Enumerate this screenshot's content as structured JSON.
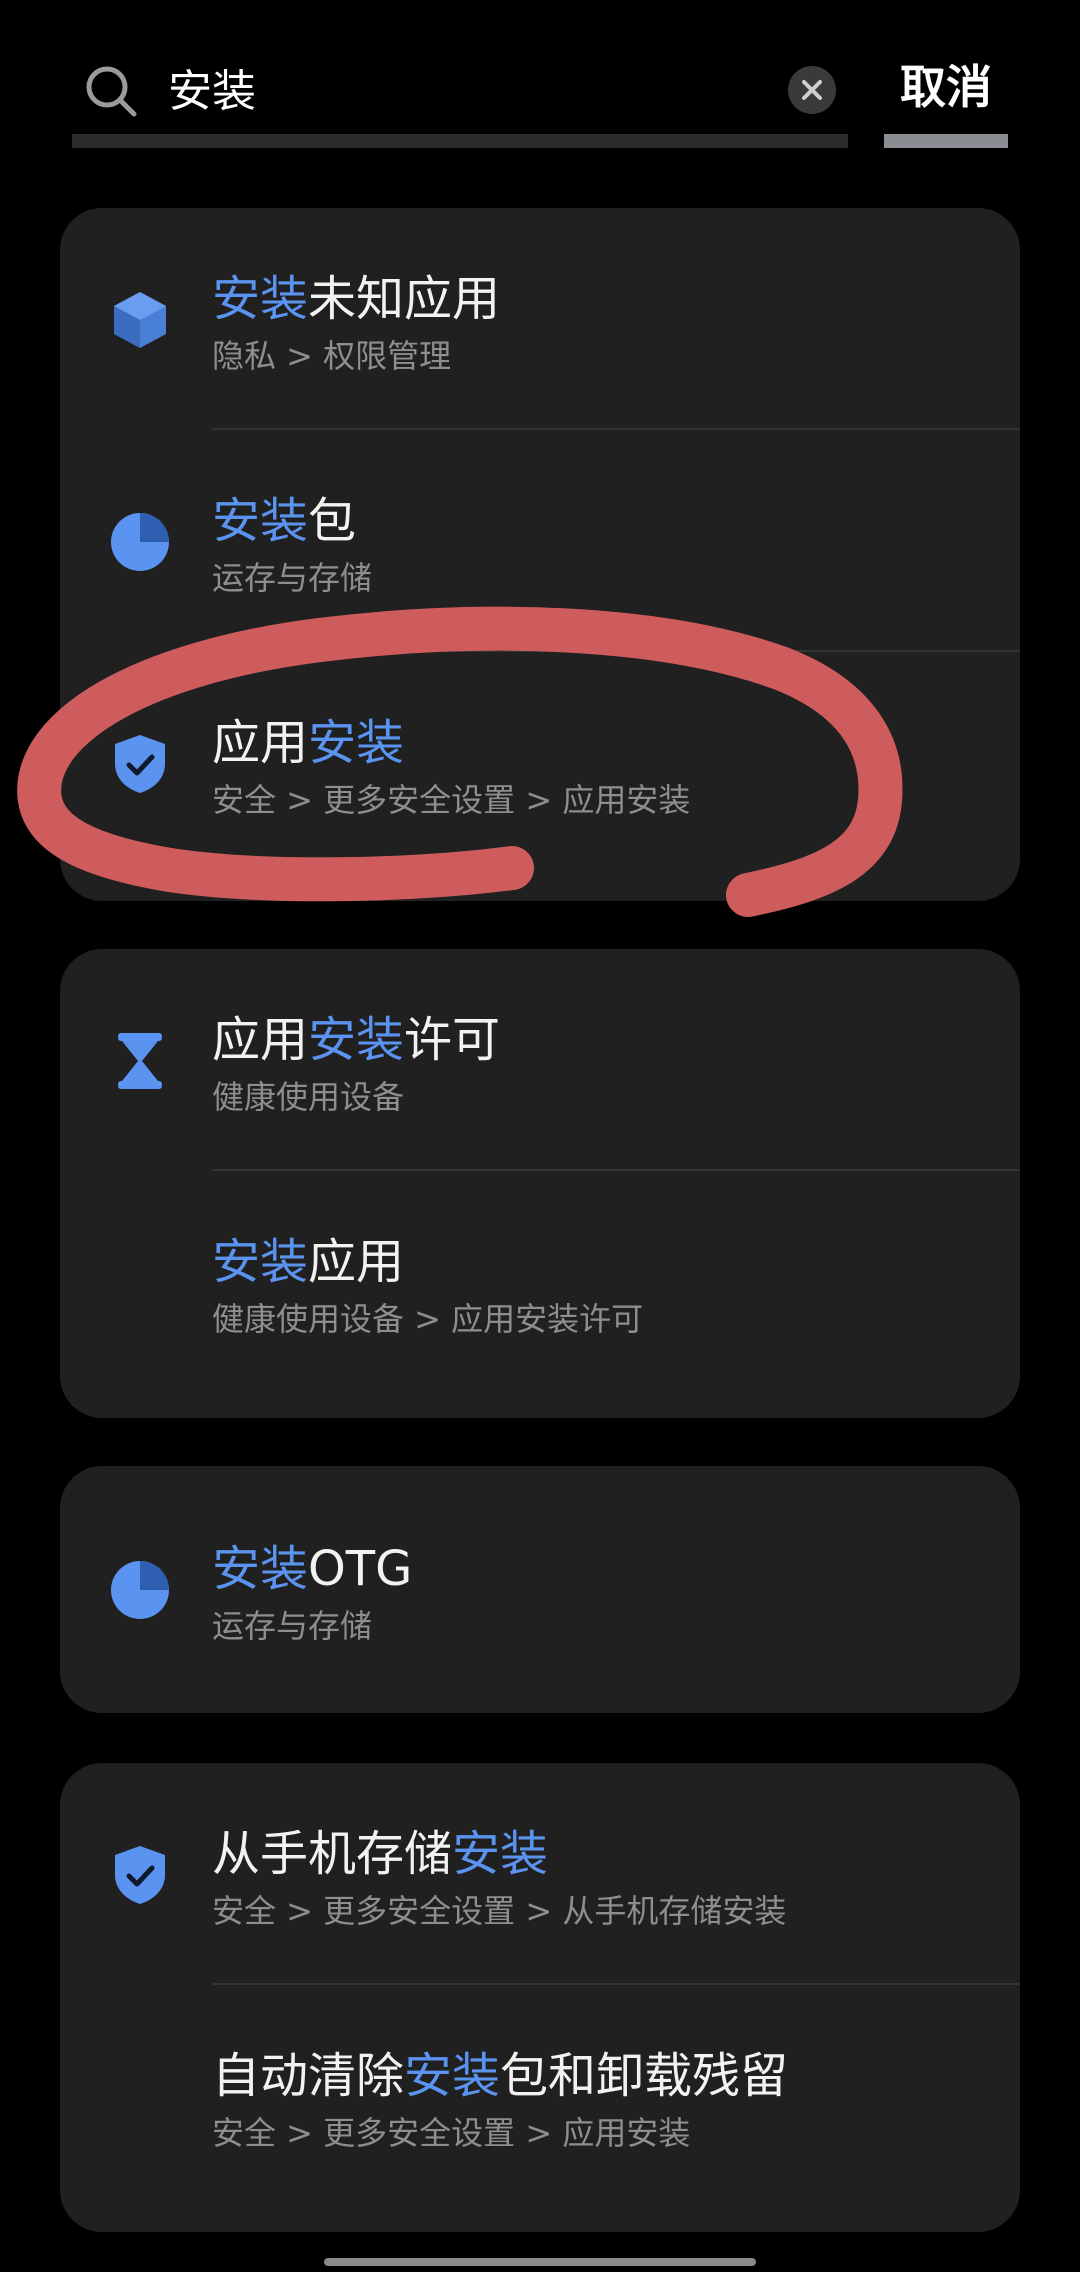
{
  "search": {
    "query": "安装",
    "cancel_label": "取消"
  },
  "colors": {
    "highlight": "#5a93f0",
    "annotation": "#e06464",
    "card_bg": "#202020"
  },
  "cards": [
    {
      "rows": [
        {
          "icon": "cube-icon",
          "title_hl": "安装",
          "title_rest": "未知应用",
          "subtitle": "隐私 > 权限管理"
        },
        {
          "icon": "pie-chart-icon",
          "title_hl": "安装",
          "title_rest": "包",
          "subtitle": "运存与存储"
        },
        {
          "icon": "shield-check-icon",
          "title_pre": "应用",
          "title_hl": "安装",
          "subtitle": "安全 > 更多安全设置 > 应用安装"
        }
      ]
    },
    {
      "rows": [
        {
          "icon": "hourglass-icon",
          "title_pre": "应用",
          "title_hl": "安装",
          "title_rest": "许可",
          "subtitle": "健康使用设备"
        },
        {
          "title_hl": "安装",
          "title_rest": "应用",
          "subtitle": "健康使用设备 > 应用安装许可"
        }
      ]
    },
    {
      "rows": [
        {
          "icon": "pie-chart-icon",
          "title_hl": "安装",
          "title_rest": "OTG",
          "subtitle": "运存与存储"
        }
      ]
    },
    {
      "rows": [
        {
          "icon": "shield-check-icon",
          "title_pre": "从手机存储",
          "title_hl": "安装",
          "subtitle": "安全 > 更多安全设置 > 从手机存储安装"
        },
        {
          "title_pre": "自动清除",
          "title_hl": "安装",
          "title_rest": "包和卸载残留",
          "subtitle": "安全 > 更多安全设置 > 应用安装"
        }
      ]
    }
  ]
}
